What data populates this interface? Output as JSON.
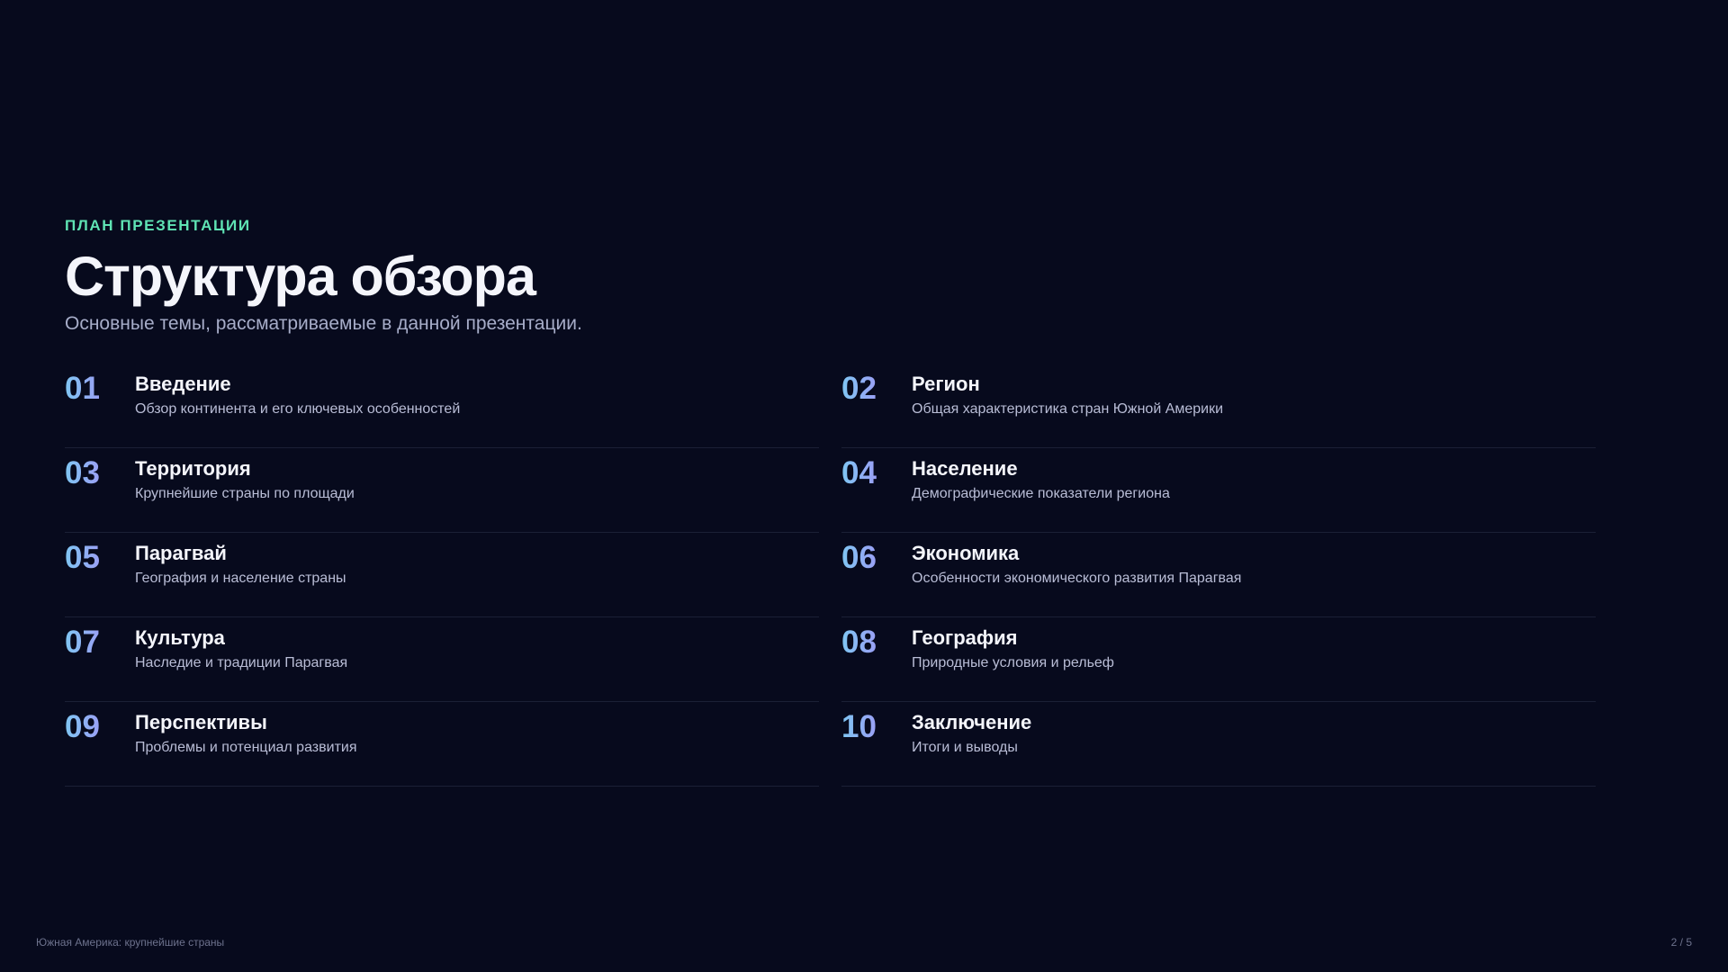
{
  "slide": {
    "eyebrow": "ПЛАН ПРЕЗЕНТАЦИИ",
    "title": "Структура обзора",
    "subtitle": "Основные темы, рассматриваемые в данной презентации."
  },
  "agenda": [
    {
      "num": "01",
      "title": "Введение",
      "desc": "Обзор континента и его ключевых особенностей"
    },
    {
      "num": "02",
      "title": "Регион",
      "desc": "Общая характеристика стран Южной Америки"
    },
    {
      "num": "03",
      "title": "Территория",
      "desc": "Крупнейшие страны по площади"
    },
    {
      "num": "04",
      "title": "Население",
      "desc": "Демографические показатели региона"
    },
    {
      "num": "05",
      "title": "Парагвай",
      "desc": "География и население страны"
    },
    {
      "num": "06",
      "title": "Экономика",
      "desc": "Особенности экономического развития Парагвая"
    },
    {
      "num": "07",
      "title": "Культура",
      "desc": "Наследие и традиции Парагвая"
    },
    {
      "num": "08",
      "title": "География",
      "desc": "Природные условия и рельеф"
    },
    {
      "num": "09",
      "title": "Перспективы",
      "desc": "Проблемы и потенциал развития"
    },
    {
      "num": "10",
      "title": "Заключение",
      "desc": "Итоги и выводы"
    }
  ],
  "footer": {
    "deck_title": "Южная Америка: крупнейшие страны",
    "page": "2 / 5"
  },
  "colors": {
    "background": "#070a1d",
    "accent": "#5fe3b4",
    "number_gradient_start": "#7fc6f3",
    "number_gradient_end": "#9aa0f5"
  }
}
